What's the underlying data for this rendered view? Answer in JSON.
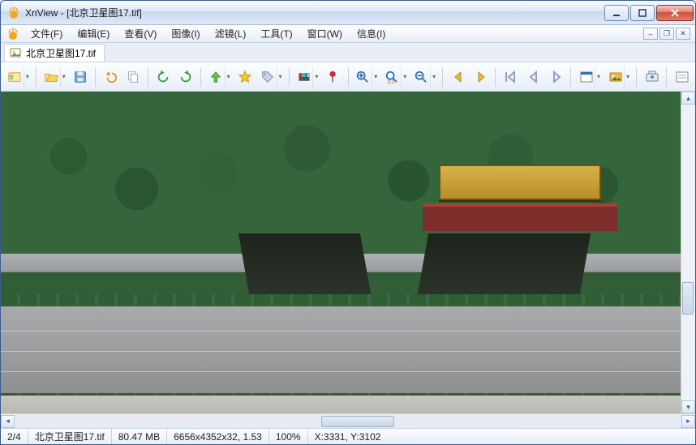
{
  "window": {
    "title": "XnView - [北京卫星图17.tif]"
  },
  "menu": {
    "file": "文件(F)",
    "edit": "编辑(E)",
    "view": "查看(V)",
    "image": "图像(I)",
    "filter": "滤镜(L)",
    "tools": "工具(T)",
    "window": "窗口(W)",
    "info": "信息(I)"
  },
  "tab": {
    "label": "北京卫星图17.tif"
  },
  "toolbar": {
    "browse": "browse",
    "open": "open",
    "save": "save",
    "undo": "undo",
    "copy": "copy",
    "rotL": "rotate-left",
    "rotR": "rotate-right",
    "up": "up",
    "star": "star",
    "tag": "tag",
    "palette": "palette",
    "pin": "pin",
    "zoomIn": "zoom-in",
    "zoom11": "zoom-1-1",
    "zoomOut": "zoom-out",
    "prev": "prev",
    "next": "next",
    "first": "first",
    "prevFile": "prev-file",
    "nextFile": "next-file",
    "fit": "fit",
    "slide": "slideshow",
    "acquire": "acquire",
    "opts": "opts"
  },
  "status": {
    "index": "2/4",
    "filename": "北京卫星图17.tif",
    "filesize": "80.47 MB",
    "dims": "6656x4352x32, 1.53",
    "zoom": "100%",
    "coords": "X:3331, Y:3102"
  }
}
